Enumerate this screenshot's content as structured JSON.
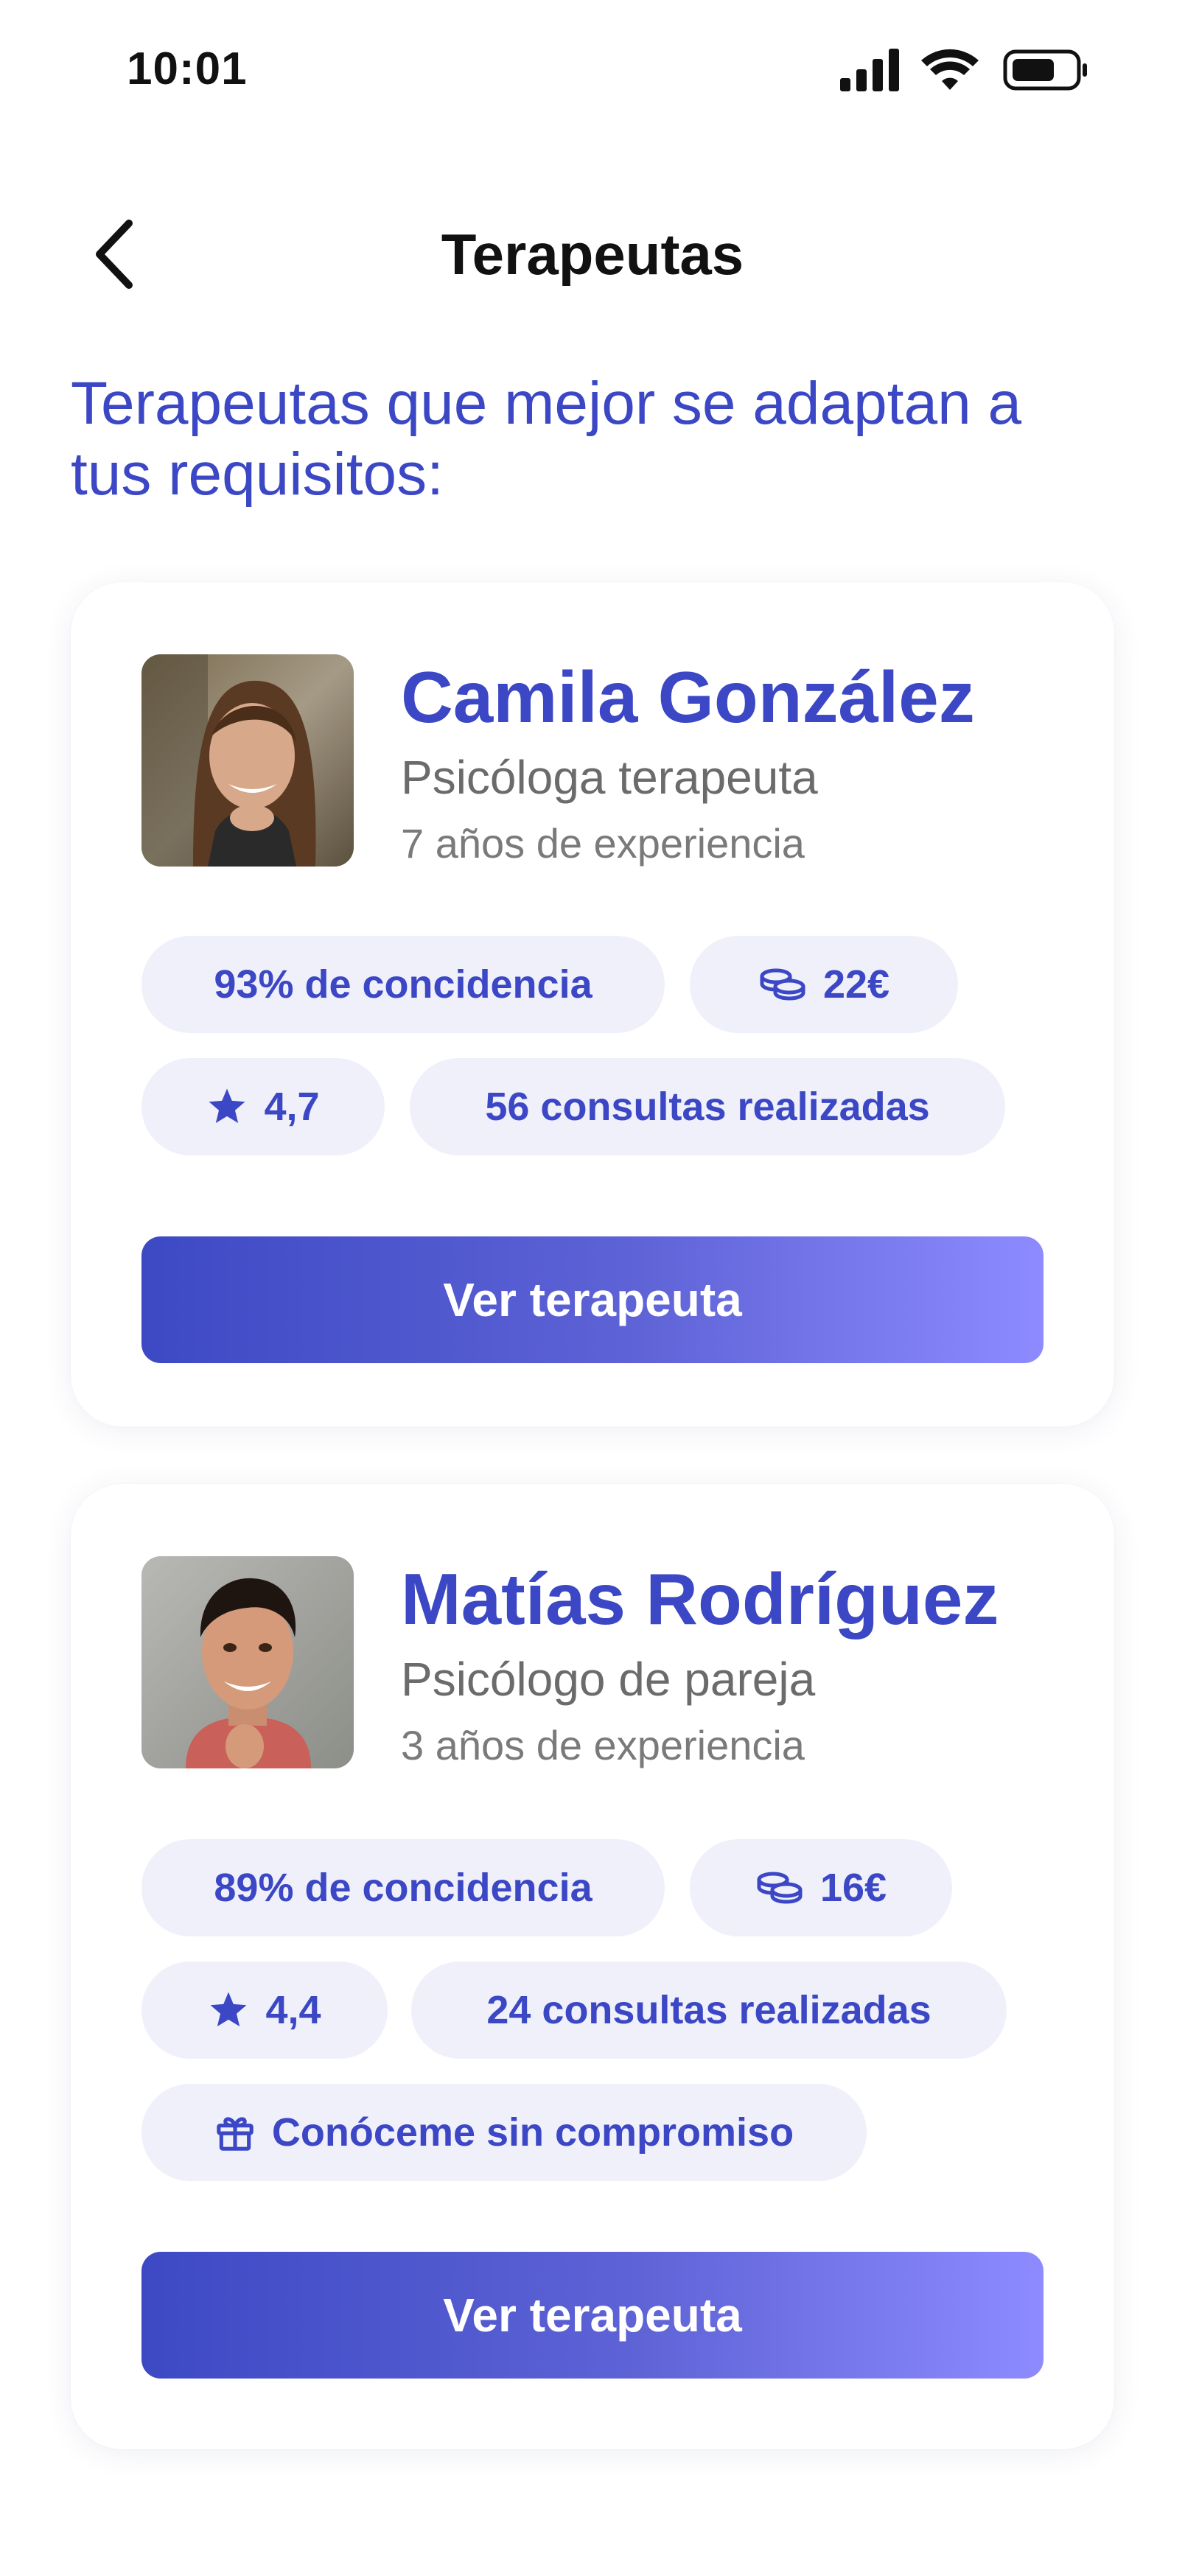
{
  "status_bar": {
    "time": "10:01"
  },
  "header": {
    "title": "Terapeutas"
  },
  "section_heading": "Terapeutas que mejor se adaptan a tus requisitos:",
  "therapists": [
    {
      "name": "Camila González",
      "role": "Psicóloga terapeuta",
      "experience": "7 años de experiencia",
      "match": "93% de concidencia",
      "price": "22€",
      "rating": "4,7",
      "sessions": "56 consultas realizadas",
      "cta_label": "Ver terapeuta"
    },
    {
      "name": "Matías Rodríguez",
      "role": "Psicólogo de pareja",
      "experience": "3 años de experiencia",
      "match": "89% de concidencia",
      "price": "16€",
      "rating": "4,4",
      "sessions": "24 consultas realizadas",
      "free_intro": "Conóceme sin compromiso",
      "cta_label": "Ver terapeuta"
    }
  ],
  "colors": {
    "accent": "#3b47c4",
    "chip_background": "#f0f0fb",
    "button_gradient_start": "#3d49c4",
    "button_gradient_end": "#8d8bff"
  },
  "icons": [
    "back-chevron-icon",
    "signal-icon",
    "wifi-icon",
    "battery-icon",
    "coins-icon",
    "star-icon",
    "gift-icon"
  ]
}
